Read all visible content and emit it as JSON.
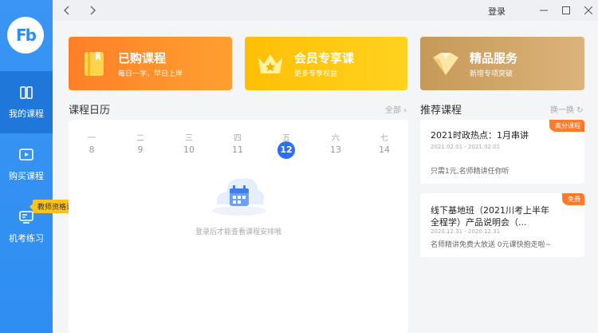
{
  "sidebar": {
    "logo_text": "Fb",
    "items": [
      {
        "label": "我的课程",
        "icon": "book-open-icon"
      },
      {
        "label": "购买课程",
        "icon": "video-play-icon"
      },
      {
        "label": "机考练习",
        "icon": "computer-exam-icon"
      }
    ],
    "tooltip": "教师资格证"
  },
  "titlebar": {
    "back_icon": "chevron-left-icon",
    "forward_icon": "chevron-right-icon",
    "login": "登录",
    "minimize_icon": "minimize-icon",
    "maximize_icon": "maximize-icon",
    "close_icon": "close-icon"
  },
  "cards": [
    {
      "title": "已购课程",
      "subtitle": "每日一学，早日上岸",
      "icon": "book-icon",
      "color_from": "#ff8a2b",
      "color_to": "#ffa12c"
    },
    {
      "title": "会员专享课",
      "subtitle": "更多专享权益",
      "icon": "crown-icon",
      "color_from": "#ffc107",
      "color_to": "#ffcf1f"
    },
    {
      "title": "精品服务",
      "subtitle": "新增专项突破",
      "icon": "diamond-icon",
      "color_from": "#c89b5a",
      "color_to": "#d8b078"
    }
  ],
  "calendar": {
    "title": "课程日历",
    "all_link": "全部",
    "weekdays": [
      "一",
      "二",
      "三",
      "四",
      "五",
      "六",
      "七"
    ],
    "days": [
      "8",
      "9",
      "10",
      "11",
      "12",
      "13",
      "14"
    ],
    "today_index": 4,
    "empty_text": "登录后才能查看课程安排哦",
    "accent": "#2d6ff0"
  },
  "recommend": {
    "title": "推荐课程",
    "refresh": "换一换",
    "items": [
      {
        "badge": "高分课程",
        "title": "2021时政热点：1月串讲",
        "date": "2021.02.01 - 2021.02.01",
        "desc": "只需1元,名师精讲任你听"
      },
      {
        "badge": "免费",
        "title": "线下基地班（2021川考上半年全程学）产品说明会（...",
        "date": "2020.12.31 - 2020.12.31",
        "desc": "名师精讲免费大放送 0元课快抱走啦~"
      }
    ],
    "badge_color": "#ff7a2b"
  }
}
